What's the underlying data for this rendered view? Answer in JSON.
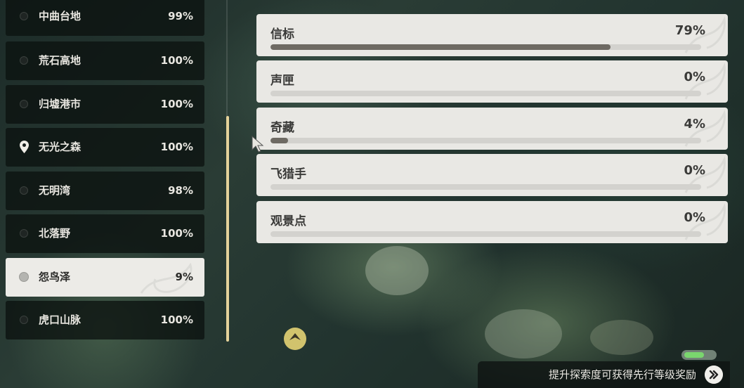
{
  "regions": [
    {
      "name": "中曲台地",
      "percent": "99%",
      "icon": "dot-icon"
    },
    {
      "name": "荒石高地",
      "percent": "100%",
      "icon": "dot-icon"
    },
    {
      "name": "归墟港市",
      "percent": "100%",
      "icon": "dot-icon"
    },
    {
      "name": "无光之森",
      "percent": "100%",
      "icon": "location-pin-icon"
    },
    {
      "name": "无明湾",
      "percent": "98%",
      "icon": "dot-icon"
    },
    {
      "name": "北落野",
      "percent": "100%",
      "icon": "dot-icon"
    },
    {
      "name": "怨鸟泽",
      "percent": "9%",
      "icon": "dot-icon",
      "selected": true
    },
    {
      "name": "虎口山脉",
      "percent": "100%",
      "icon": "dot-icon"
    }
  ],
  "categories": [
    {
      "label": "信标",
      "value": "79%",
      "progress": 0.79
    },
    {
      "label": "声匣",
      "value": "0%",
      "progress": 0.0
    },
    {
      "label": "奇藏",
      "value": "4%",
      "progress": 0.04
    },
    {
      "label": "飞猎手",
      "value": "0%",
      "progress": 0.0
    },
    {
      "label": "观景点",
      "value": "0%",
      "progress": 0.0
    }
  ],
  "banner": {
    "text": "提升探索度可获得先行等级奖励",
    "icon": "double-chevron-right-icon"
  },
  "colors": {
    "accent_scroll": "#e4d29a",
    "card_bg": "#e9e8e4",
    "progress_fill": "#6e6a63",
    "selected_bg": "#ecebe7"
  }
}
